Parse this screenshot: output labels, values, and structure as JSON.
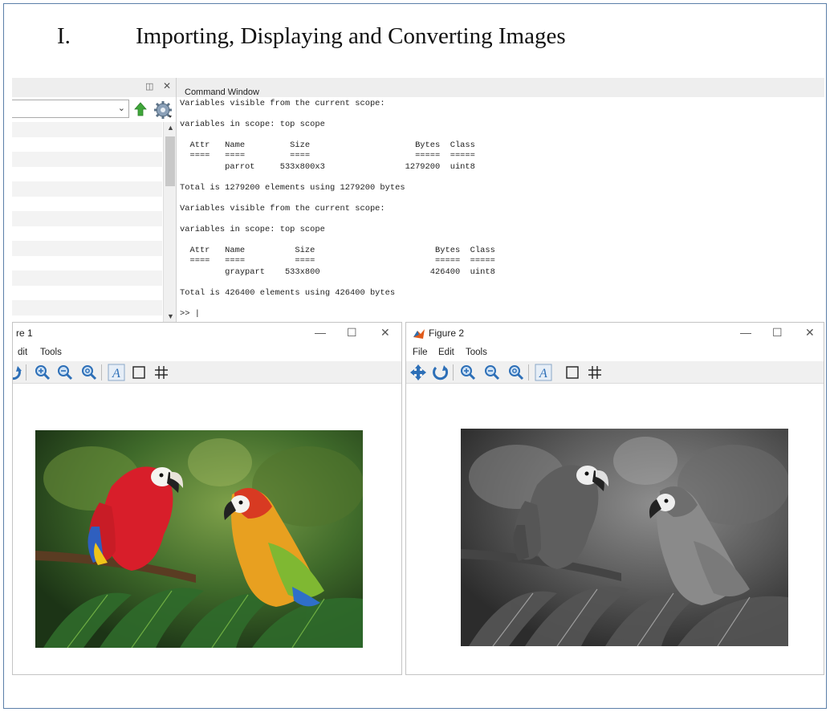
{
  "document": {
    "heading_number": "I.",
    "heading_text": "Importing, Displaying and Converting Images"
  },
  "workspace": {
    "list_rows": 13
  },
  "command_window": {
    "title": "Command Window",
    "output": "Variables visible from the current scope:\n\nvariables in scope: top scope\n\n  Attr   Name         Size                     Bytes  Class\n  ====   ====         ====                     =====  =====\n         parrot     533x800x3                1279200  uint8\n\nTotal is 1279200 elements using 1279200 bytes\n\nVariables visible from the current scope:\n\nvariables in scope: top scope\n\n  Attr   Name          Size                        Bytes  Class\n  ====   ====          ====                        =====  =====\n         graypart    533x800                      426400  uint8\n\nTotal is 426400 elements using 426400 bytes\n\n>> |"
  },
  "figure1": {
    "title": "re 1",
    "menu": [
      "dit",
      "Tools"
    ]
  },
  "figure2": {
    "title": "Figure 2",
    "menu": [
      "File",
      "Edit",
      "Tools"
    ]
  },
  "window_controls": {
    "minimize": "—",
    "maximize": "☐",
    "close": "✕"
  },
  "colors": {
    "frame_border": "#5b7fa8",
    "panel_header": "#eeeeee",
    "toolbar": "#f0f0f0"
  }
}
